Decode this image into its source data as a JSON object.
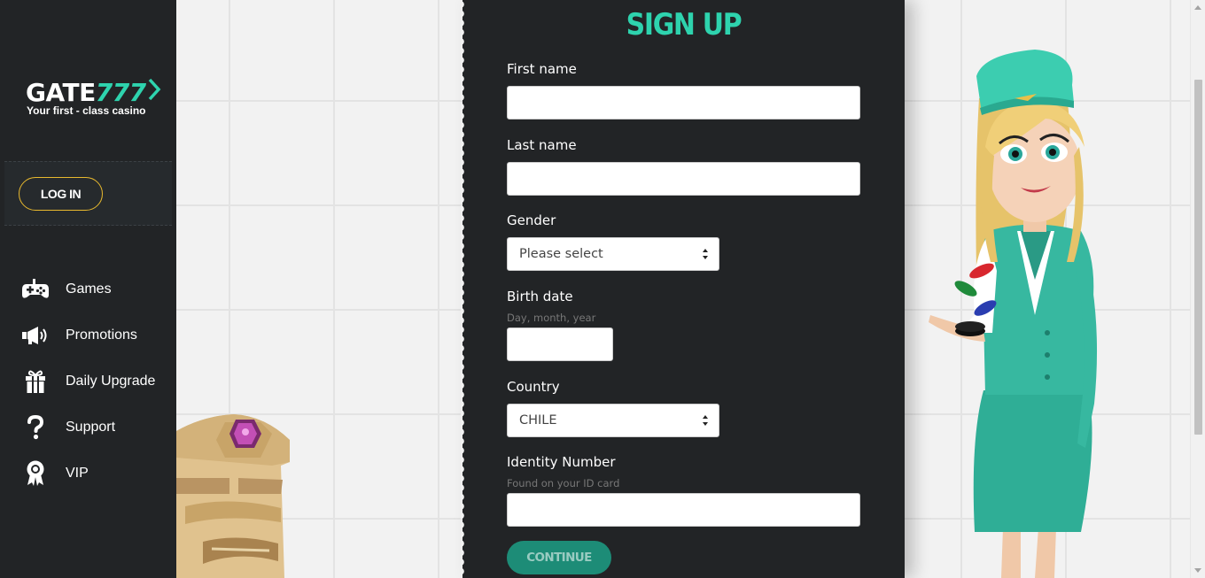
{
  "brand": {
    "logo_prefix": "GATE",
    "logo_number": "777",
    "tagline": "Your first - class casino",
    "accent_color": "#2ed3ae",
    "login_border_color": "#e8b92e"
  },
  "sidebar": {
    "login_label": "LOG IN",
    "items": [
      {
        "label": "Games",
        "icon": "gamepad-icon"
      },
      {
        "label": "Promotions",
        "icon": "megaphone-icon"
      },
      {
        "label": "Daily Upgrade",
        "icon": "gift-icon"
      },
      {
        "label": "Support",
        "icon": "question-icon"
      },
      {
        "label": "VIP",
        "icon": "award-ribbon-icon"
      }
    ]
  },
  "form": {
    "title": "SIGN UP",
    "first_name": {
      "label": "First name",
      "value": ""
    },
    "last_name": {
      "label": "Last name",
      "value": ""
    },
    "gender": {
      "label": "Gender",
      "value": "Please select"
    },
    "birth_date": {
      "label": "Birth date",
      "hint": "Day, month, year",
      "value": ""
    },
    "country": {
      "label": "Country",
      "value": "CHILE"
    },
    "identity_number": {
      "label": "Identity Number",
      "hint": "Found on your ID card",
      "value": ""
    },
    "continue_label": "CONTINUE"
  }
}
